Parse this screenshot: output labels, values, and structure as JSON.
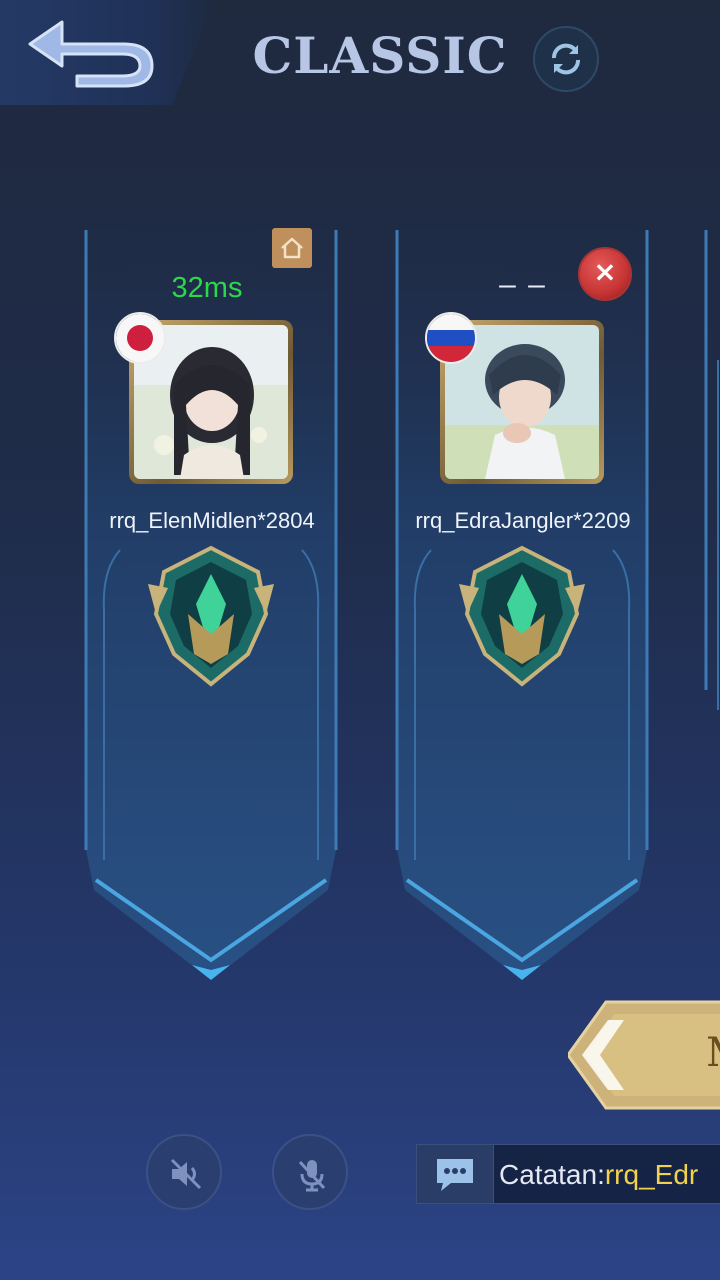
{
  "header": {
    "title": "CLASSIC"
  },
  "players": [
    {
      "username": "rrq_ElenMidlen*2804",
      "ping": "32ms",
      "flag": "japan-flag",
      "badge": "home-icon"
    },
    {
      "username": "rrq_EdraJangler*2209",
      "ping": "– –",
      "flag": "russia-flag",
      "badge": "close-icon"
    }
  ],
  "confirm": {
    "label": "M"
  },
  "chat": {
    "prefix": "Catatan:",
    "name": "rrq_Edr"
  },
  "colors": {
    "ping_good": "#2ad84a",
    "chat_name": "#f2d24d",
    "title": "#b8c6e6"
  }
}
